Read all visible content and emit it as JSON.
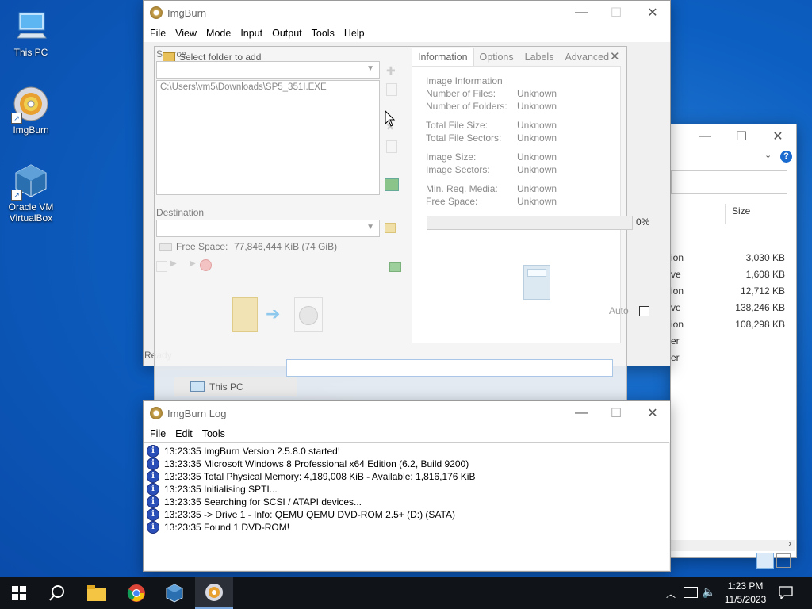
{
  "desktop": {
    "icons": [
      {
        "label": "This PC",
        "icon": "this-pc-icon"
      },
      {
        "label": "ImgBurn",
        "icon": "imgburn-icon"
      },
      {
        "label": "Oracle VM VirtualBox",
        "icon": "virtualbox-icon"
      }
    ]
  },
  "main_window": {
    "title": "ImgBurn",
    "menu": [
      "File",
      "View",
      "Mode",
      "Input",
      "Output",
      "Tools",
      "Help"
    ],
    "status": "Ready"
  },
  "build_dialog": {
    "source_label": "Source",
    "select_folder_label": "Select folder to add",
    "source_path": "C:\\Users\\vm5\\Downloads\\SP5_351I.EXE",
    "destination_label": "Destination",
    "free_space_label": "Free Space:",
    "free_space_value": "77,846,444 KiB  (74 GiB)",
    "tabs": [
      "Information",
      "Options",
      "Labels",
      "Advanced"
    ],
    "active_tab": "Information",
    "info": {
      "heading": "Image Information",
      "rows": [
        {
          "label": "Number of Files:",
          "value": "Unknown"
        },
        {
          "label": "Number of Folders:",
          "value": "Unknown"
        },
        {
          "label": "Total File Size:",
          "value": "Unknown"
        },
        {
          "label": "Total File Sectors:",
          "value": "Unknown"
        },
        {
          "label": "Image Size:",
          "value": "Unknown"
        },
        {
          "label": "Image Sectors:",
          "value": "Unknown"
        },
        {
          "label": "Min. Req. Media:",
          "value": "Unknown"
        },
        {
          "label": "Free Space:",
          "value": "Unknown"
        }
      ],
      "progress_label": "0%",
      "progress_value": 0,
      "auto_label": "Auto"
    }
  },
  "explorer": {
    "size_header": "Size",
    "rows": [
      {
        "type": "ion",
        "size": "3,030 KB"
      },
      {
        "type": "ve",
        "size": "1,608 KB"
      },
      {
        "type": "ion",
        "size": "12,712 KB"
      },
      {
        "type": "ve",
        "size": "138,246 KB"
      },
      {
        "type": "ion",
        "size": "108,298 KB"
      },
      {
        "type": "er",
        "size": ""
      },
      {
        "type": "er",
        "size": ""
      }
    ],
    "nav_this_pc": "This PC"
  },
  "log_window": {
    "title": "ImgBurn Log",
    "menu": [
      "File",
      "Edit",
      "Tools"
    ],
    "lines": [
      "13:23:35 ImgBurn Version 2.5.8.0 started!",
      "13:23:35 Microsoft Windows 8 Professional x64 Edition (6.2, Build 9200)",
      "13:23:35 Total Physical Memory: 4,189,008 KiB  -  Available: 1,816,176 KiB",
      "13:23:35 Initialising SPTI...",
      "13:23:35 Searching for SCSI / ATAPI devices...",
      "13:23:35 -> Drive 1 - Info: QEMU QEMU DVD-ROM 2.5+ (D:) (SATA)",
      "13:23:35 Found 1 DVD-ROM!"
    ]
  },
  "taskbar": {
    "time": "1:23 PM",
    "date": "11/5/2023"
  },
  "colors": {
    "desktop": "#0c5fc1",
    "taskbar": "#101418",
    "info_icon": "#2b4fb8"
  }
}
